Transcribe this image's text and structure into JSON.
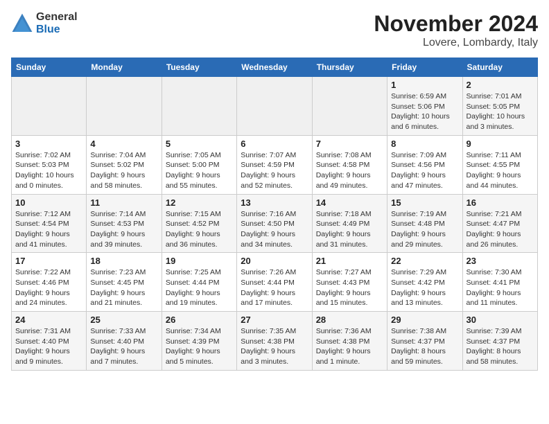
{
  "header": {
    "logo_general": "General",
    "logo_blue": "Blue",
    "title": "November 2024",
    "subtitle": "Lovere, Lombardy, Italy"
  },
  "days_of_week": [
    "Sunday",
    "Monday",
    "Tuesday",
    "Wednesday",
    "Thursday",
    "Friday",
    "Saturday"
  ],
  "weeks": [
    [
      {
        "day": "",
        "info": ""
      },
      {
        "day": "",
        "info": ""
      },
      {
        "day": "",
        "info": ""
      },
      {
        "day": "",
        "info": ""
      },
      {
        "day": "",
        "info": ""
      },
      {
        "day": "1",
        "info": "Sunrise: 6:59 AM\nSunset: 5:06 PM\nDaylight: 10 hours and 6 minutes."
      },
      {
        "day": "2",
        "info": "Sunrise: 7:01 AM\nSunset: 5:05 PM\nDaylight: 10 hours and 3 minutes."
      }
    ],
    [
      {
        "day": "3",
        "info": "Sunrise: 7:02 AM\nSunset: 5:03 PM\nDaylight: 10 hours and 0 minutes."
      },
      {
        "day": "4",
        "info": "Sunrise: 7:04 AM\nSunset: 5:02 PM\nDaylight: 9 hours and 58 minutes."
      },
      {
        "day": "5",
        "info": "Sunrise: 7:05 AM\nSunset: 5:00 PM\nDaylight: 9 hours and 55 minutes."
      },
      {
        "day": "6",
        "info": "Sunrise: 7:07 AM\nSunset: 4:59 PM\nDaylight: 9 hours and 52 minutes."
      },
      {
        "day": "7",
        "info": "Sunrise: 7:08 AM\nSunset: 4:58 PM\nDaylight: 9 hours and 49 minutes."
      },
      {
        "day": "8",
        "info": "Sunrise: 7:09 AM\nSunset: 4:56 PM\nDaylight: 9 hours and 47 minutes."
      },
      {
        "day": "9",
        "info": "Sunrise: 7:11 AM\nSunset: 4:55 PM\nDaylight: 9 hours and 44 minutes."
      }
    ],
    [
      {
        "day": "10",
        "info": "Sunrise: 7:12 AM\nSunset: 4:54 PM\nDaylight: 9 hours and 41 minutes."
      },
      {
        "day": "11",
        "info": "Sunrise: 7:14 AM\nSunset: 4:53 PM\nDaylight: 9 hours and 39 minutes."
      },
      {
        "day": "12",
        "info": "Sunrise: 7:15 AM\nSunset: 4:52 PM\nDaylight: 9 hours and 36 minutes."
      },
      {
        "day": "13",
        "info": "Sunrise: 7:16 AM\nSunset: 4:50 PM\nDaylight: 9 hours and 34 minutes."
      },
      {
        "day": "14",
        "info": "Sunrise: 7:18 AM\nSunset: 4:49 PM\nDaylight: 9 hours and 31 minutes."
      },
      {
        "day": "15",
        "info": "Sunrise: 7:19 AM\nSunset: 4:48 PM\nDaylight: 9 hours and 29 minutes."
      },
      {
        "day": "16",
        "info": "Sunrise: 7:21 AM\nSunset: 4:47 PM\nDaylight: 9 hours and 26 minutes."
      }
    ],
    [
      {
        "day": "17",
        "info": "Sunrise: 7:22 AM\nSunset: 4:46 PM\nDaylight: 9 hours and 24 minutes."
      },
      {
        "day": "18",
        "info": "Sunrise: 7:23 AM\nSunset: 4:45 PM\nDaylight: 9 hours and 21 minutes."
      },
      {
        "day": "19",
        "info": "Sunrise: 7:25 AM\nSunset: 4:44 PM\nDaylight: 9 hours and 19 minutes."
      },
      {
        "day": "20",
        "info": "Sunrise: 7:26 AM\nSunset: 4:44 PM\nDaylight: 9 hours and 17 minutes."
      },
      {
        "day": "21",
        "info": "Sunrise: 7:27 AM\nSunset: 4:43 PM\nDaylight: 9 hours and 15 minutes."
      },
      {
        "day": "22",
        "info": "Sunrise: 7:29 AM\nSunset: 4:42 PM\nDaylight: 9 hours and 13 minutes."
      },
      {
        "day": "23",
        "info": "Sunrise: 7:30 AM\nSunset: 4:41 PM\nDaylight: 9 hours and 11 minutes."
      }
    ],
    [
      {
        "day": "24",
        "info": "Sunrise: 7:31 AM\nSunset: 4:40 PM\nDaylight: 9 hours and 9 minutes."
      },
      {
        "day": "25",
        "info": "Sunrise: 7:33 AM\nSunset: 4:40 PM\nDaylight: 9 hours and 7 minutes."
      },
      {
        "day": "26",
        "info": "Sunrise: 7:34 AM\nSunset: 4:39 PM\nDaylight: 9 hours and 5 minutes."
      },
      {
        "day": "27",
        "info": "Sunrise: 7:35 AM\nSunset: 4:38 PM\nDaylight: 9 hours and 3 minutes."
      },
      {
        "day": "28",
        "info": "Sunrise: 7:36 AM\nSunset: 4:38 PM\nDaylight: 9 hours and 1 minute."
      },
      {
        "day": "29",
        "info": "Sunrise: 7:38 AM\nSunset: 4:37 PM\nDaylight: 8 hours and 59 minutes."
      },
      {
        "day": "30",
        "info": "Sunrise: 7:39 AM\nSunset: 4:37 PM\nDaylight: 8 hours and 58 minutes."
      }
    ]
  ]
}
